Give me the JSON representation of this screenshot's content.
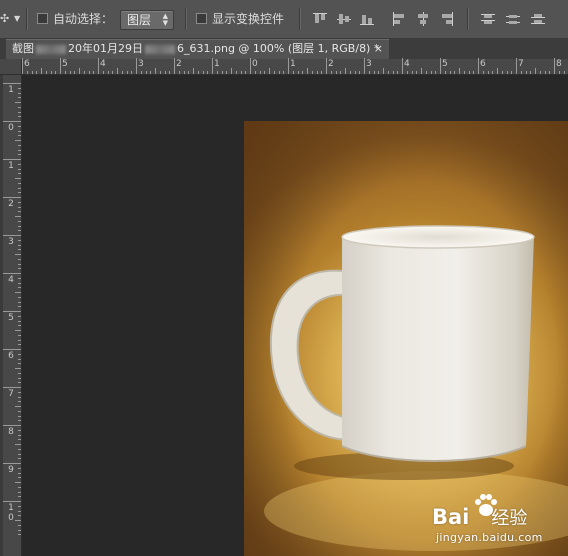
{
  "options_bar": {
    "tool_icon": "move-tool-icon",
    "auto_select_label": "自动选择：",
    "auto_select_checked": false,
    "auto_select_target": "图层",
    "show_transform_label": "显示变换控件",
    "show_transform_checked": false,
    "align_icons": [
      "align-top-edges-icon",
      "align-vertical-centers-icon",
      "align-bottom-edges-icon",
      "align-left-edges-icon",
      "align-horizontal-centers-icon",
      "align-right-edges-icon",
      "distribute-top-icon",
      "distribute-vertical-centers-icon",
      "distribute-bottom-icon"
    ]
  },
  "document_tab": {
    "title_pre": "截图",
    "title_mid": "20年01月29日",
    "title_post": "6_631.png @ 100% (图层 1, RGB/8) *",
    "close": "×"
  },
  "ruler": {
    "horizontal_labels": [
      "6",
      "5",
      "4",
      "3",
      "2",
      "1",
      "0",
      "1",
      "2",
      "3",
      "4",
      "5",
      "6",
      "7",
      "8"
    ],
    "vertical_labels": [
      "1",
      "0",
      "1",
      "2",
      "3",
      "4",
      "5",
      "6",
      "7",
      "8",
      "9",
      "10"
    ]
  },
  "watermark": {
    "brand": "Bai",
    "brand_suffix": "经验",
    "url": "jingyan.baidu.com"
  },
  "colors": {
    "ui_bar": "#535353",
    "canvas_bg": "#282828",
    "photo_warm": "#d9ad4f"
  }
}
